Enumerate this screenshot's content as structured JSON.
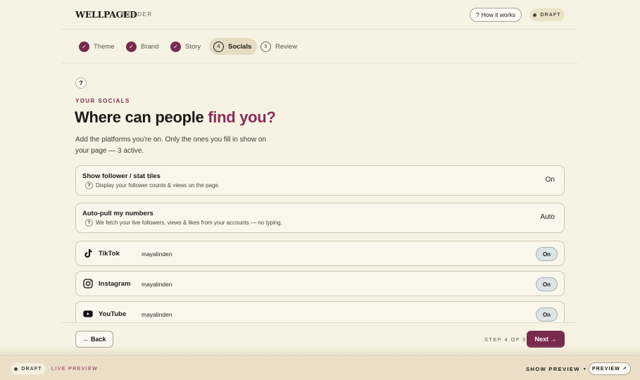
{
  "header": {
    "logo": "WELLPAGED",
    "section": "BUILDER",
    "how_it_works": "How it works",
    "help_glyph": "?",
    "draft_label": "DRAFT"
  },
  "steps": [
    {
      "label": "Theme",
      "state": "done",
      "marker": "✓"
    },
    {
      "label": "Brand",
      "state": "done",
      "marker": "✓"
    },
    {
      "label": "Story",
      "state": "done",
      "marker": "✓"
    },
    {
      "label": "Socials",
      "state": "active",
      "marker": "4"
    },
    {
      "label": "Review",
      "state": "pending",
      "marker": "5"
    }
  ],
  "main": {
    "help_glyph": "?",
    "eyebrow": "YOUR SOCIALS",
    "title_prefix": "Where can people ",
    "title_accent": "find you?",
    "description": "Add the platforms you're on. Only the ones you fill in show on your page — 3 active."
  },
  "settings": [
    {
      "title": "Show follower / stat tiles",
      "subtitle": "Display your follower counts & views on the page.",
      "value": "On"
    },
    {
      "title": "Auto-pull my numbers",
      "subtitle": "We fetch your live followers, views & likes from your accounts — no typing.",
      "value": "Auto"
    }
  ],
  "platforms": [
    {
      "name": "TikTok",
      "handle": "mayalinden",
      "toggle": "On",
      "icon": "tiktok-icon"
    },
    {
      "name": "Instagram",
      "handle": "mayalinden",
      "toggle": "On",
      "icon": "instagram-icon"
    },
    {
      "name": "YouTube",
      "handle": "mayalinden",
      "toggle": "On",
      "icon": "youtube-icon"
    }
  ],
  "footer_nav": {
    "back": "← Back",
    "step_count": "STEP 4 OF 5",
    "next": "Next →"
  },
  "bottom_bar": {
    "draft": "DRAFT",
    "live_preview": "LIVE PREVIEW",
    "show_preview": "SHOW PREVIEW",
    "preview": "PREVIEW ↗"
  },
  "colors": {
    "accent": "#7a2a4e",
    "background": "#f7f3e4"
  }
}
